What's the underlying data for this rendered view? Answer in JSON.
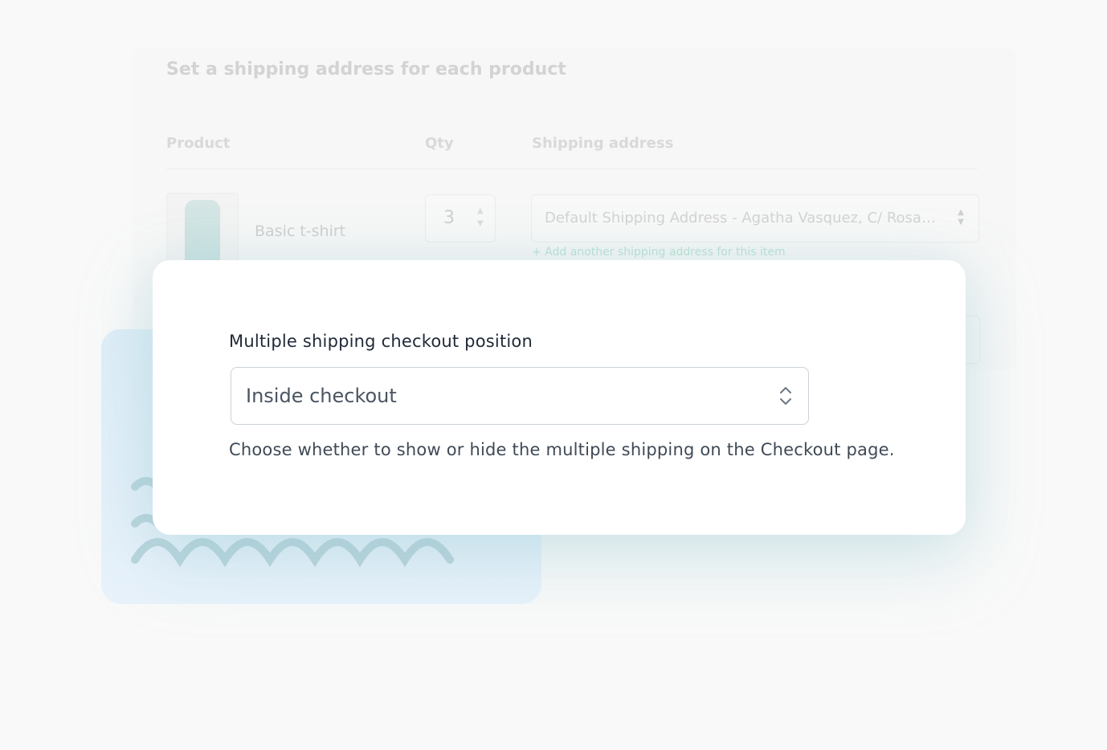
{
  "background": {
    "title": "Set a shipping address for each product",
    "columns": {
      "product": "Product",
      "qty": "Qty",
      "shipping_address": "Shipping address"
    },
    "row": {
      "product_name": "Basic t-shirt",
      "qty": "3",
      "address": "Default Shipping Address - Agatha Vasquez, C/ Rosa ...",
      "add_link": "+ Add another shipping address for this item"
    }
  },
  "modal": {
    "label": "Multiple shipping checkout position",
    "select_value": "Inside checkout",
    "help_text": "Choose whether to show or hide the multiple shipping on the Checkout page."
  },
  "icons": {
    "select": "chevron-up-down-icon"
  },
  "colors": {
    "wave": "#b9d4dc",
    "panel": "#e3f0fa"
  }
}
